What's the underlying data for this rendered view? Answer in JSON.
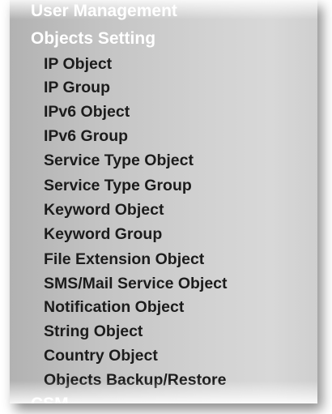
{
  "sidebar": {
    "sections": {
      "user_management": "User Management",
      "objects_setting": "Objects Setting",
      "csm": "CSM"
    },
    "items": [
      "IP Object",
      "IP Group",
      "IPv6 Object",
      "IPv6 Group",
      "Service Type Object",
      "Service Type Group",
      "Keyword Object",
      "Keyword Group",
      "File Extension Object",
      "SMS/Mail Service Object",
      "Notification Object",
      "String Object",
      "Country Object",
      "Objects Backup/Restore"
    ]
  }
}
